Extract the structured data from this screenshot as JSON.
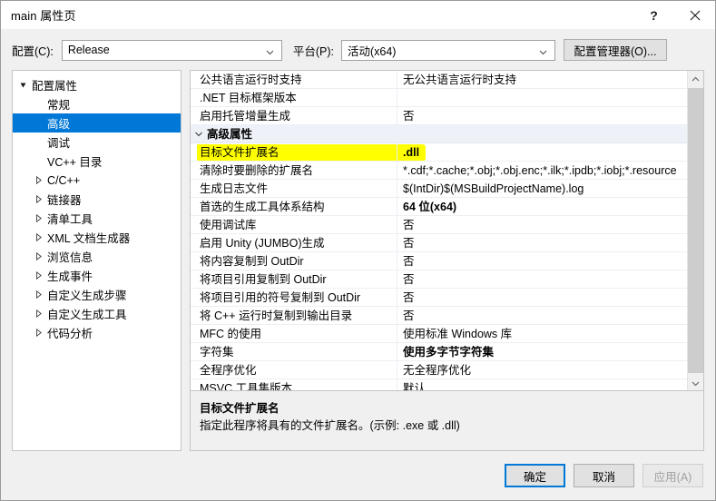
{
  "window": {
    "title": "main 属性页",
    "help_icon": "question-mark-icon",
    "close_icon": "close-icon"
  },
  "toolbar": {
    "configuration_label": "配置(C):",
    "configuration_value": "Release",
    "platform_label": "平台(P):",
    "platform_value": "活动(x64)",
    "config_manager_label": "配置管理器(O)..."
  },
  "tree": {
    "items": [
      {
        "label": "配置属性",
        "depth": 0,
        "arrow": "expanded",
        "selected": false
      },
      {
        "label": "常规",
        "depth": 1,
        "arrow": "none",
        "selected": false
      },
      {
        "label": "高级",
        "depth": 1,
        "arrow": "none",
        "selected": true
      },
      {
        "label": "调试",
        "depth": 1,
        "arrow": "none",
        "selected": false
      },
      {
        "label": "VC++ 目录",
        "depth": 1,
        "arrow": "none",
        "selected": false
      },
      {
        "label": "C/C++",
        "depth": 1,
        "arrow": "collapsed",
        "selected": false
      },
      {
        "label": "链接器",
        "depth": 1,
        "arrow": "collapsed",
        "selected": false
      },
      {
        "label": "清单工具",
        "depth": 1,
        "arrow": "collapsed",
        "selected": false
      },
      {
        "label": "XML 文档生成器",
        "depth": 1,
        "arrow": "collapsed",
        "selected": false
      },
      {
        "label": "浏览信息",
        "depth": 1,
        "arrow": "collapsed",
        "selected": false
      },
      {
        "label": "生成事件",
        "depth": 1,
        "arrow": "collapsed",
        "selected": false
      },
      {
        "label": "自定义生成步骤",
        "depth": 1,
        "arrow": "collapsed",
        "selected": false
      },
      {
        "label": "自定义生成工具",
        "depth": 1,
        "arrow": "collapsed",
        "selected": false
      },
      {
        "label": "代码分析",
        "depth": 1,
        "arrow": "collapsed",
        "selected": false
      }
    ]
  },
  "grid": {
    "rows": [
      {
        "name": "公共语言运行时支持",
        "value": "无公共语言运行时支持",
        "category": false,
        "bold": false,
        "highlight": false
      },
      {
        "name": ".NET 目标框架版本",
        "value": "",
        "category": false,
        "bold": false,
        "highlight": false
      },
      {
        "name": "启用托管增量生成",
        "value": "否",
        "category": false,
        "bold": false,
        "highlight": false
      },
      {
        "name": "高级属性",
        "value": "",
        "category": true,
        "bold": false,
        "highlight": false
      },
      {
        "name": "目标文件扩展名",
        "value": ".dll",
        "category": false,
        "bold": true,
        "highlight": true
      },
      {
        "name": "清除时要删除的扩展名",
        "value": "*.cdf;*.cache;*.obj;*.obj.enc;*.ilk;*.ipdb;*.iobj;*.resource",
        "category": false,
        "bold": false,
        "highlight": false
      },
      {
        "name": "生成日志文件",
        "value": "$(IntDir)$(MSBuildProjectName).log",
        "category": false,
        "bold": false,
        "highlight": false
      },
      {
        "name": "首选的生成工具体系结构",
        "value": "64 位(x64)",
        "category": false,
        "bold": true,
        "highlight": false
      },
      {
        "name": "使用调试库",
        "value": "否",
        "category": false,
        "bold": false,
        "highlight": false
      },
      {
        "name": "启用 Unity (JUMBO)生成",
        "value": "否",
        "category": false,
        "bold": false,
        "highlight": false
      },
      {
        "name": "将内容复制到 OutDir",
        "value": "否",
        "category": false,
        "bold": false,
        "highlight": false
      },
      {
        "name": "将项目引用复制到 OutDir",
        "value": "否",
        "category": false,
        "bold": false,
        "highlight": false
      },
      {
        "name": "将项目引用的符号复制到 OutDir",
        "value": "否",
        "category": false,
        "bold": false,
        "highlight": false
      },
      {
        "name": "将 C++ 运行时复制到输出目录",
        "value": "否",
        "category": false,
        "bold": false,
        "highlight": false
      },
      {
        "name": "MFC 的使用",
        "value": "使用标准 Windows 库",
        "category": false,
        "bold": false,
        "highlight": false
      },
      {
        "name": "字符集",
        "value": "使用多字节字符集",
        "category": false,
        "bold": true,
        "highlight": false
      },
      {
        "name": "全程序优化",
        "value": "无全程序优化",
        "category": false,
        "bold": false,
        "highlight": false
      },
      {
        "name": "MSVC 工具集版本",
        "value": "默认",
        "category": false,
        "bold": false,
        "highlight": false
      }
    ],
    "scrollbar": {
      "up_icon": "chevron-up-icon",
      "down_icon": "chevron-down-icon"
    }
  },
  "description": {
    "title": "目标文件扩展名",
    "text": "指定此程序将具有的文件扩展名。(示例: .exe 或 .dll)"
  },
  "footer": {
    "ok_label": "确定",
    "cancel_label": "取消",
    "apply_label": "应用(A)"
  },
  "colors": {
    "accent": "#0078d7",
    "highlight": "#ffff00",
    "category_bg": "#eef2f8",
    "dialog_bg": "#f0f0f0"
  }
}
